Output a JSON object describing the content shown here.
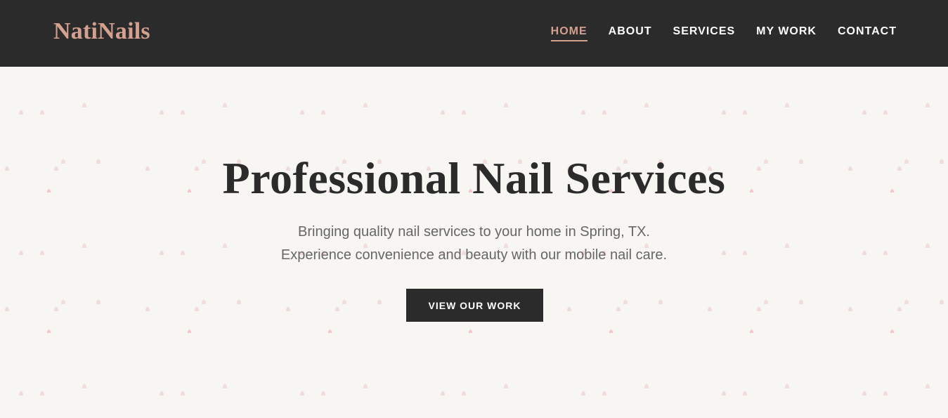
{
  "brand": {
    "name": "NatiNails",
    "accent_color": "#d4a190",
    "dark_color": "#2b2b2b"
  },
  "nav": {
    "items": [
      {
        "label": "HOME",
        "active": true
      },
      {
        "label": "ABOUT",
        "active": false
      },
      {
        "label": "SERVICES",
        "active": false
      },
      {
        "label": "MY WORK",
        "active": false
      },
      {
        "label": "CONTACT",
        "active": false
      }
    ]
  },
  "hero": {
    "title": "Professional Nail Services",
    "subtitle_line1": "Bringing quality nail services to your home in Spring, TX.",
    "subtitle_line2": "Experience convenience and beauty with our mobile nail care.",
    "cta_label": "VIEW OUR WORK",
    "background_color": "#f8f6f2",
    "pattern_icon": "nail-polish-icon",
    "pattern_color": "#f1dcdc"
  }
}
